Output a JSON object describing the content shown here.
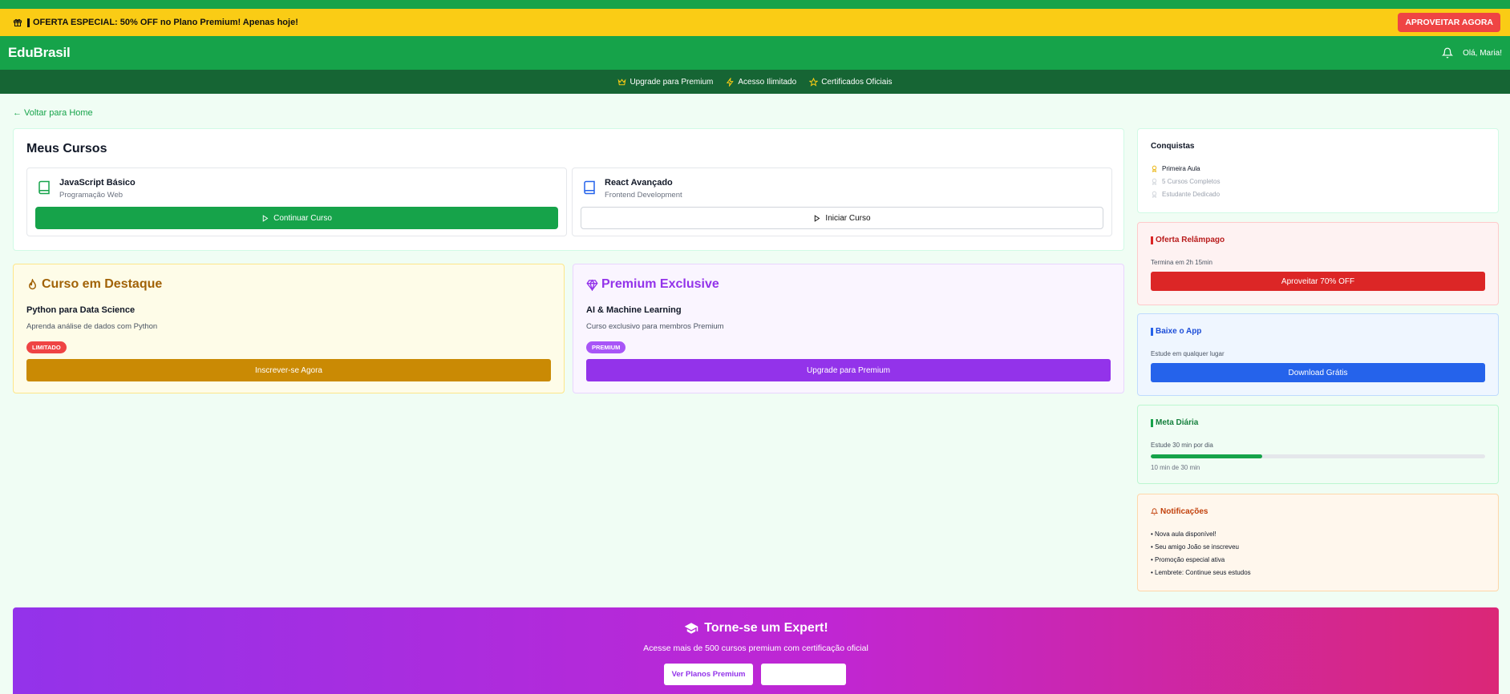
{
  "promo": {
    "text": "OFERTA ESPECIAL: 50% OFF no Plano Premium! Apenas hoje!",
    "cta": "APROVEITAR AGORA"
  },
  "header": {
    "logo": "EduBrasil",
    "greeting": "Olá, Maria!"
  },
  "subnav": {
    "items": [
      "Upgrade para Premium",
      "Acesso Ilimitado",
      "Certificados Oficiais"
    ]
  },
  "back_link": "← Voltar para Home",
  "my_courses": {
    "title": "Meus Cursos",
    "courses": [
      {
        "title": "JavaScript Básico",
        "subtitle": "Programação Web",
        "action": "Continuar Curso"
      },
      {
        "title": "React Avançado",
        "subtitle": "Frontend Development",
        "action": "Iniciar Curso"
      }
    ]
  },
  "featured": {
    "title": "Curso em Destaque",
    "course": "Python para Data Science",
    "description": "Aprenda análise de dados com Python",
    "badge": "LIMITADO",
    "action": "Inscrever-se Agora"
  },
  "premium": {
    "title": "Premium Exclusive",
    "course": "AI & Machine Learning",
    "description": "Curso exclusivo para membros Premium",
    "badge": "PREMIUM",
    "action": "Upgrade para Premium"
  },
  "achievements": {
    "title": "Conquistas",
    "items": [
      {
        "label": "Primeira Aula",
        "unlocked": true
      },
      {
        "label": "5 Cursos Completos",
        "unlocked": false
      },
      {
        "label": "Estudante Dedicado",
        "unlocked": false
      }
    ]
  },
  "flash_offer": {
    "title": "Oferta Relâmpago",
    "text": "Termina em 2h 15min",
    "action": "Aproveitar 70% OFF"
  },
  "app_download": {
    "title": "Baixe o App",
    "text": "Estude em qualquer lugar",
    "action": "Download Grátis"
  },
  "daily_goal": {
    "title": "Meta Diária",
    "text": "Estude 30 min por dia",
    "progress": 0.333,
    "progress_text": "10 min de 30 min"
  },
  "notifications": {
    "title": "Notificações",
    "items": [
      "• Nova aula disponível!",
      "• Seu amigo João se inscreveu",
      "• Promoção especial ativa",
      "• Lembrete: Continue seus estudos"
    ]
  },
  "expert_banner": {
    "title": "Torne-se um Expert!",
    "subtitle": "Acesse mais de 500 cursos premium com certificação oficial",
    "primary_action": "Ver Planos Premium"
  },
  "colors": {
    "brand": "#16a34a",
    "promo": "#facc15",
    "danger": "#ef4444",
    "premium": "#9333ea",
    "info": "#2563eb"
  }
}
